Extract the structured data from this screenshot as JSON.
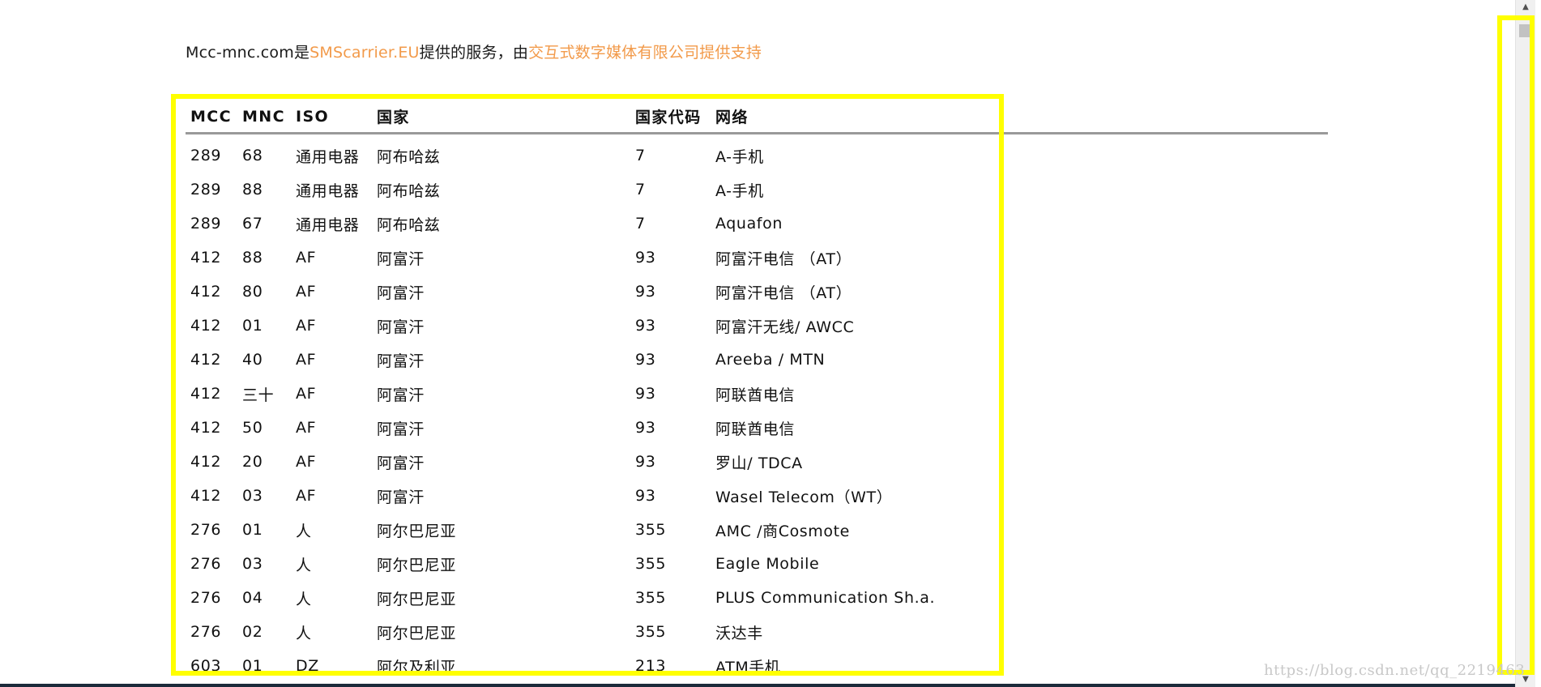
{
  "credit": {
    "prefix": "Mcc-mnc.com是",
    "link1": "SMScarrier.EU",
    "middle": "提供的服务，由",
    "link2": "交互式数字媒体有限公司提供支持"
  },
  "table": {
    "headers": [
      "MCC",
      "MNC",
      "ISO",
      "国家",
      "国家代码",
      "网络"
    ],
    "rows": [
      [
        "289",
        "68",
        "通用电器",
        "阿布哈兹",
        "7",
        "A-手机"
      ],
      [
        "289",
        "88",
        "通用电器",
        "阿布哈兹",
        "7",
        "A-手机"
      ],
      [
        "289",
        "67",
        "通用电器",
        "阿布哈兹",
        "7",
        "Aquafon"
      ],
      [
        "412",
        "88",
        "AF",
        "阿富汗",
        "93",
        "阿富汗电信 （AT）"
      ],
      [
        "412",
        "80",
        "AF",
        "阿富汗",
        "93",
        "阿富汗电信 （AT）"
      ],
      [
        "412",
        "01",
        "AF",
        "阿富汗",
        "93",
        "阿富汗无线/ AWCC"
      ],
      [
        "412",
        "40",
        "AF",
        "阿富汗",
        "93",
        "Areeba / MTN"
      ],
      [
        "412",
        "三十",
        "AF",
        "阿富汗",
        "93",
        "阿联酋电信"
      ],
      [
        "412",
        "50",
        "AF",
        "阿富汗",
        "93",
        "阿联酋电信"
      ],
      [
        "412",
        "20",
        "AF",
        "阿富汗",
        "93",
        "罗山/ TDCA"
      ],
      [
        "412",
        "03",
        "AF",
        "阿富汗",
        "93",
        "Wasel Telecom（WT）"
      ],
      [
        "276",
        "01",
        "人",
        "阿尔巴尼亚",
        "355",
        "AMC /商Cosmote"
      ],
      [
        "276",
        "03",
        "人",
        "阿尔巴尼亚",
        "355",
        "Eagle Mobile"
      ],
      [
        "276",
        "04",
        "人",
        "阿尔巴尼亚",
        "355",
        "PLUS Communication Sh.a."
      ],
      [
        "276",
        "02",
        "人",
        "阿尔巴尼亚",
        "355",
        "沃达丰"
      ],
      [
        "603",
        "01",
        "DZ",
        "阿尔及利亚",
        "213",
        "ATM手机"
      ]
    ]
  },
  "scrollbar": {
    "up_icon": "▲",
    "down_icon": "▼"
  },
  "watermark": "https://blog.csdn.net/qq_2219463"
}
